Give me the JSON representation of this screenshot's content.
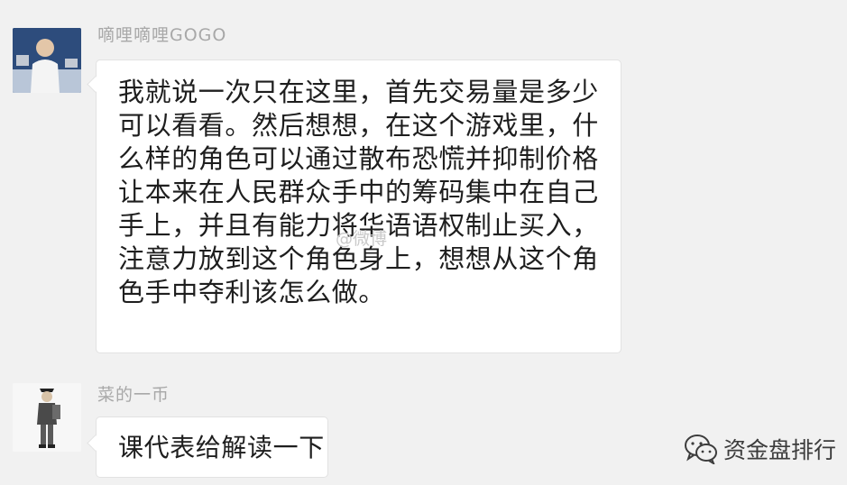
{
  "messages": [
    {
      "sender": "嘀哩嘀哩GOGO",
      "lines": [
        "我就说一次只在这里，首先交易量是多少",
        "可以看看。然后想想，在这个游戏里，什",
        "么样的角色可以通过散布恐慌并抑制价格",
        "让本来在人民群众手中的筹码集中在自己",
        "手上，并且有能力将华语语权制止买入，",
        "注意力放到这个角色身上，想想从这个角",
        "色手中夺利该怎么做。"
      ],
      "avatar_icon": "user-photo-icon"
    },
    {
      "sender": "菜的一币",
      "lines": [
        "课代表给解读一下"
      ],
      "avatar_icon": "standing-figure-icon"
    }
  ],
  "watermark": "@微博",
  "footer": {
    "icon": "wechat-icon",
    "label": "资金盘排行"
  },
  "colors": {
    "background": "#f1f1f1",
    "bubble": "#ffffff",
    "sender_name": "#a8a8a8",
    "text": "#1e1e1e"
  }
}
